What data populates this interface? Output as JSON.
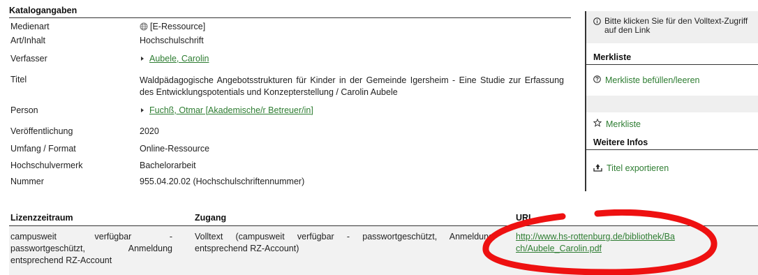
{
  "catalog": {
    "title": "Katalogangaben",
    "rows": {
      "medienart": {
        "label": "Medienart",
        "value": "[E-Ressource]"
      },
      "art": {
        "label": "Art/Inhalt",
        "value": "Hochschulschrift"
      },
      "verfasser": {
        "label": "Verfasser",
        "value": "Aubele, Carolin"
      },
      "titel": {
        "label": "Titel",
        "value": "Waldpädagogische Angebotsstrukturen für Kinder in der Gemeinde Igersheim - Eine Studie zur Erfassung des Entwicklungspotentials und Konzepterstellung / Carolin Aubele"
      },
      "person": {
        "label": "Person",
        "value": "Fuchß, Otmar [Akademische/r Betreuer/in]"
      },
      "veroeffentlichung": {
        "label": "Veröffentlichung",
        "value": "2020"
      },
      "umfang": {
        "label": "Umfang / Format",
        "value": "Online-Ressource"
      },
      "vermerk": {
        "label": "Hochschulvermerk",
        "value": "Bachelorarbeit"
      },
      "nummer": {
        "label": "Nummer",
        "value": "955.04.20.02 (Hochschulschriftennummer)"
      }
    }
  },
  "sidebar": {
    "info_text": "Bitte klicken Sie für den Volltext-Zugriff auf den Link",
    "merkliste_head": "Merkliste",
    "merkliste_fill": "Merkliste befüllen/leeren",
    "merkliste_link": "Merkliste",
    "weitere_head": "Weitere Infos",
    "export_link": "Titel exportieren"
  },
  "license": {
    "headers": {
      "col1": "Lizenzzeitraum",
      "col2": "Zugang",
      "col3": "URL"
    },
    "row": {
      "lizenzzeitraum": "campusweit verfügbar - passwortgeschützt, Anmeldung entsprechend RZ-Account",
      "zugang": "Volltext (campusweit verfügbar - passwortgeschützt, Anmeldung entsprechend RZ-Account)",
      "url": "http://www.hs-rottenburg.de/bibliothek/Bach/Aubele_Carolin.pdf"
    }
  },
  "colors": {
    "link": "#2e7d32",
    "annotation": "#ee1111",
    "panel_bg": "#efefef"
  },
  "icons": [
    "globe-icon",
    "triangle-bullet-icon",
    "info-icon",
    "question-circle-icon",
    "star-icon",
    "export-icon"
  ]
}
